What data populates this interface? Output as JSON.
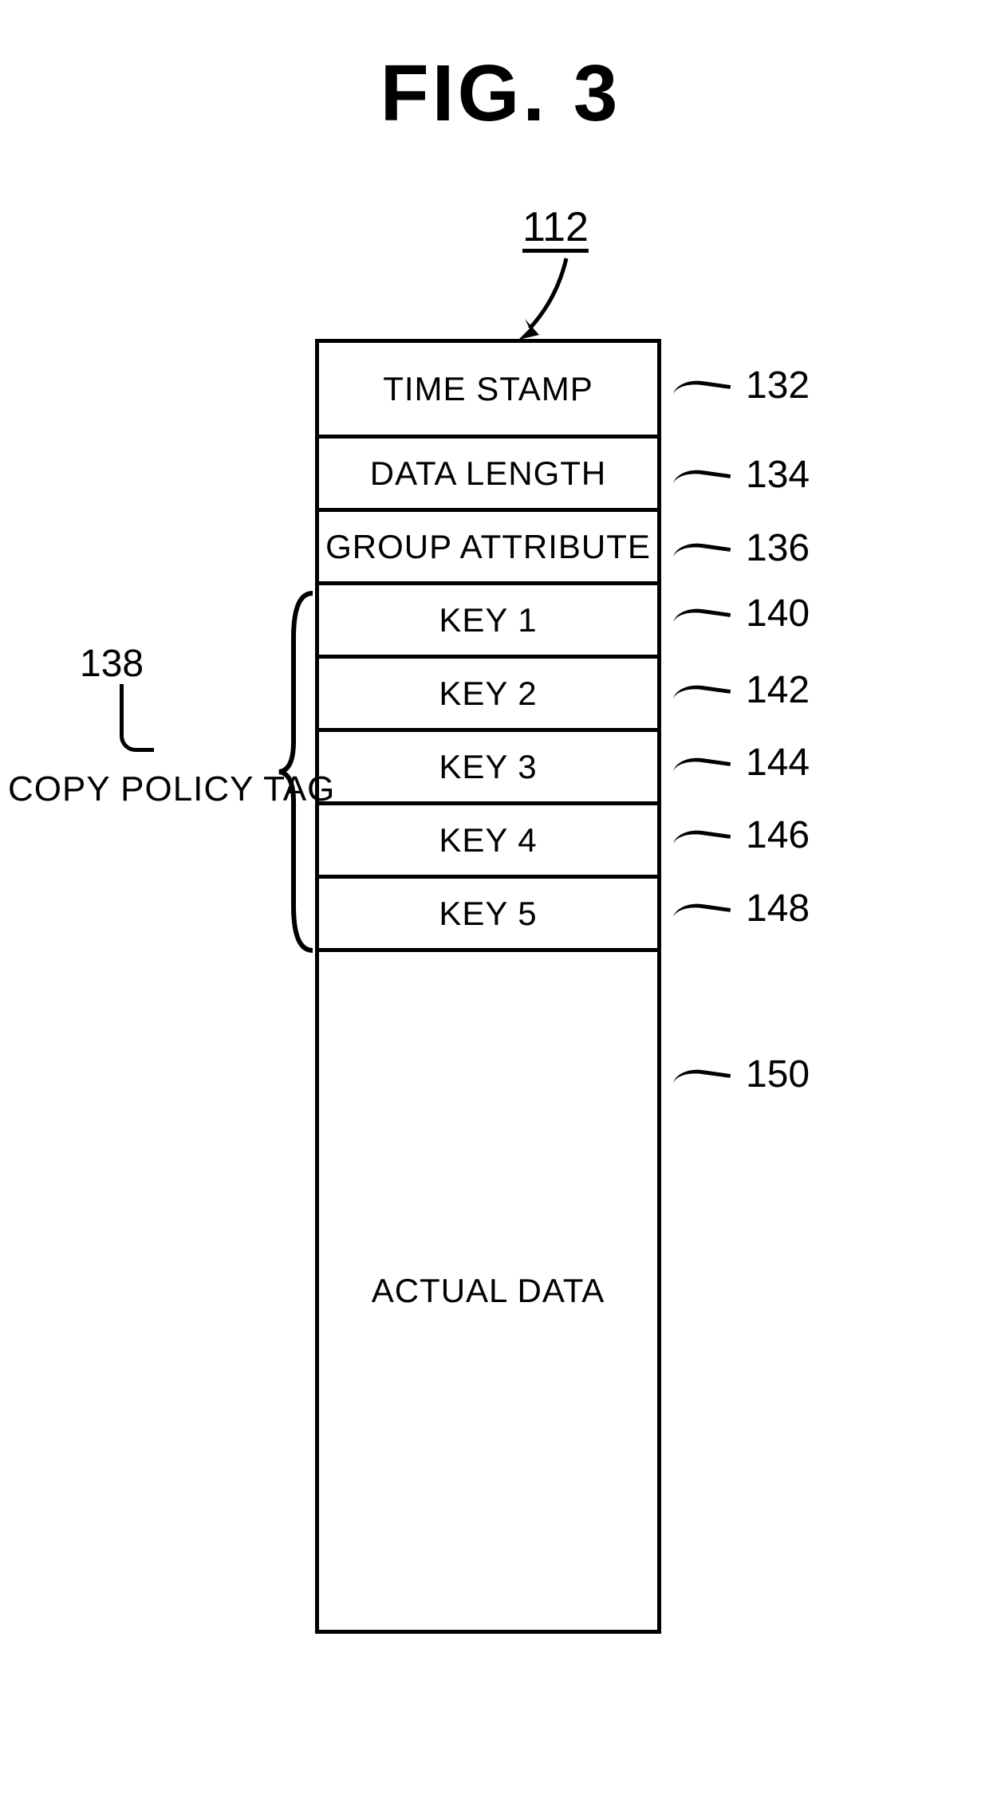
{
  "figure": {
    "title": "FIG. 3",
    "struct_ref": "112",
    "copy_policy": {
      "ref": "138",
      "label": "COPY POLICY TAG"
    },
    "cells": {
      "time_stamp": {
        "label": "TIME STAMP",
        "ref": "132"
      },
      "data_length": {
        "label": "DATA LENGTH",
        "ref": "134"
      },
      "group_attribute": {
        "label": "GROUP ATTRIBUTE",
        "ref": "136"
      },
      "key1": {
        "label": "KEY 1",
        "ref": "140"
      },
      "key2": {
        "label": "KEY 2",
        "ref": "142"
      },
      "key3": {
        "label": "KEY 3",
        "ref": "144"
      },
      "key4": {
        "label": "KEY 4",
        "ref": "146"
      },
      "key5": {
        "label": "KEY 5",
        "ref": "148"
      },
      "actual_data": {
        "label": "ACTUAL DATA",
        "ref": "150"
      }
    }
  }
}
